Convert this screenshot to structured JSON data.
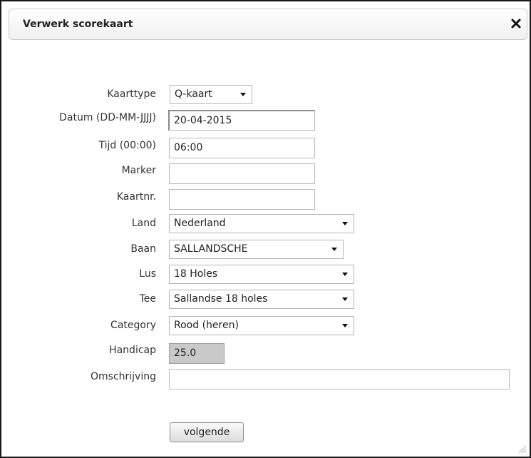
{
  "dialog": {
    "title": "Verwerk scorekaart"
  },
  "form": {
    "kaarttype": {
      "label": "Kaarttype",
      "value": "Q-kaart"
    },
    "datum": {
      "label": "Datum (DD-MM-JJJJ)",
      "value": "20-04-2015"
    },
    "tijd": {
      "label": "Tijd (00:00)",
      "value": "06:00"
    },
    "marker": {
      "label": "Marker",
      "value": ""
    },
    "kaartnr": {
      "label": "Kaartnr.",
      "value": ""
    },
    "land": {
      "label": "Land",
      "value": "Nederland"
    },
    "baan": {
      "label": "Baan",
      "value": "SALLANDSCHE"
    },
    "lus": {
      "label": "Lus",
      "value": "18 Holes"
    },
    "tee": {
      "label": "Tee",
      "value": "Sallandse 18 holes"
    },
    "category": {
      "label": "Category",
      "value": "Rood (heren)"
    },
    "handicap": {
      "label": "Handicap",
      "value": "25.0"
    },
    "omschrijving": {
      "label": "Omschrijving",
      "value": ""
    }
  },
  "actions": {
    "next_label": "volgende"
  },
  "icons": {
    "close": "close-icon",
    "dropdown": "chevron-down-icon",
    "resize": "resize-grip-icon"
  }
}
